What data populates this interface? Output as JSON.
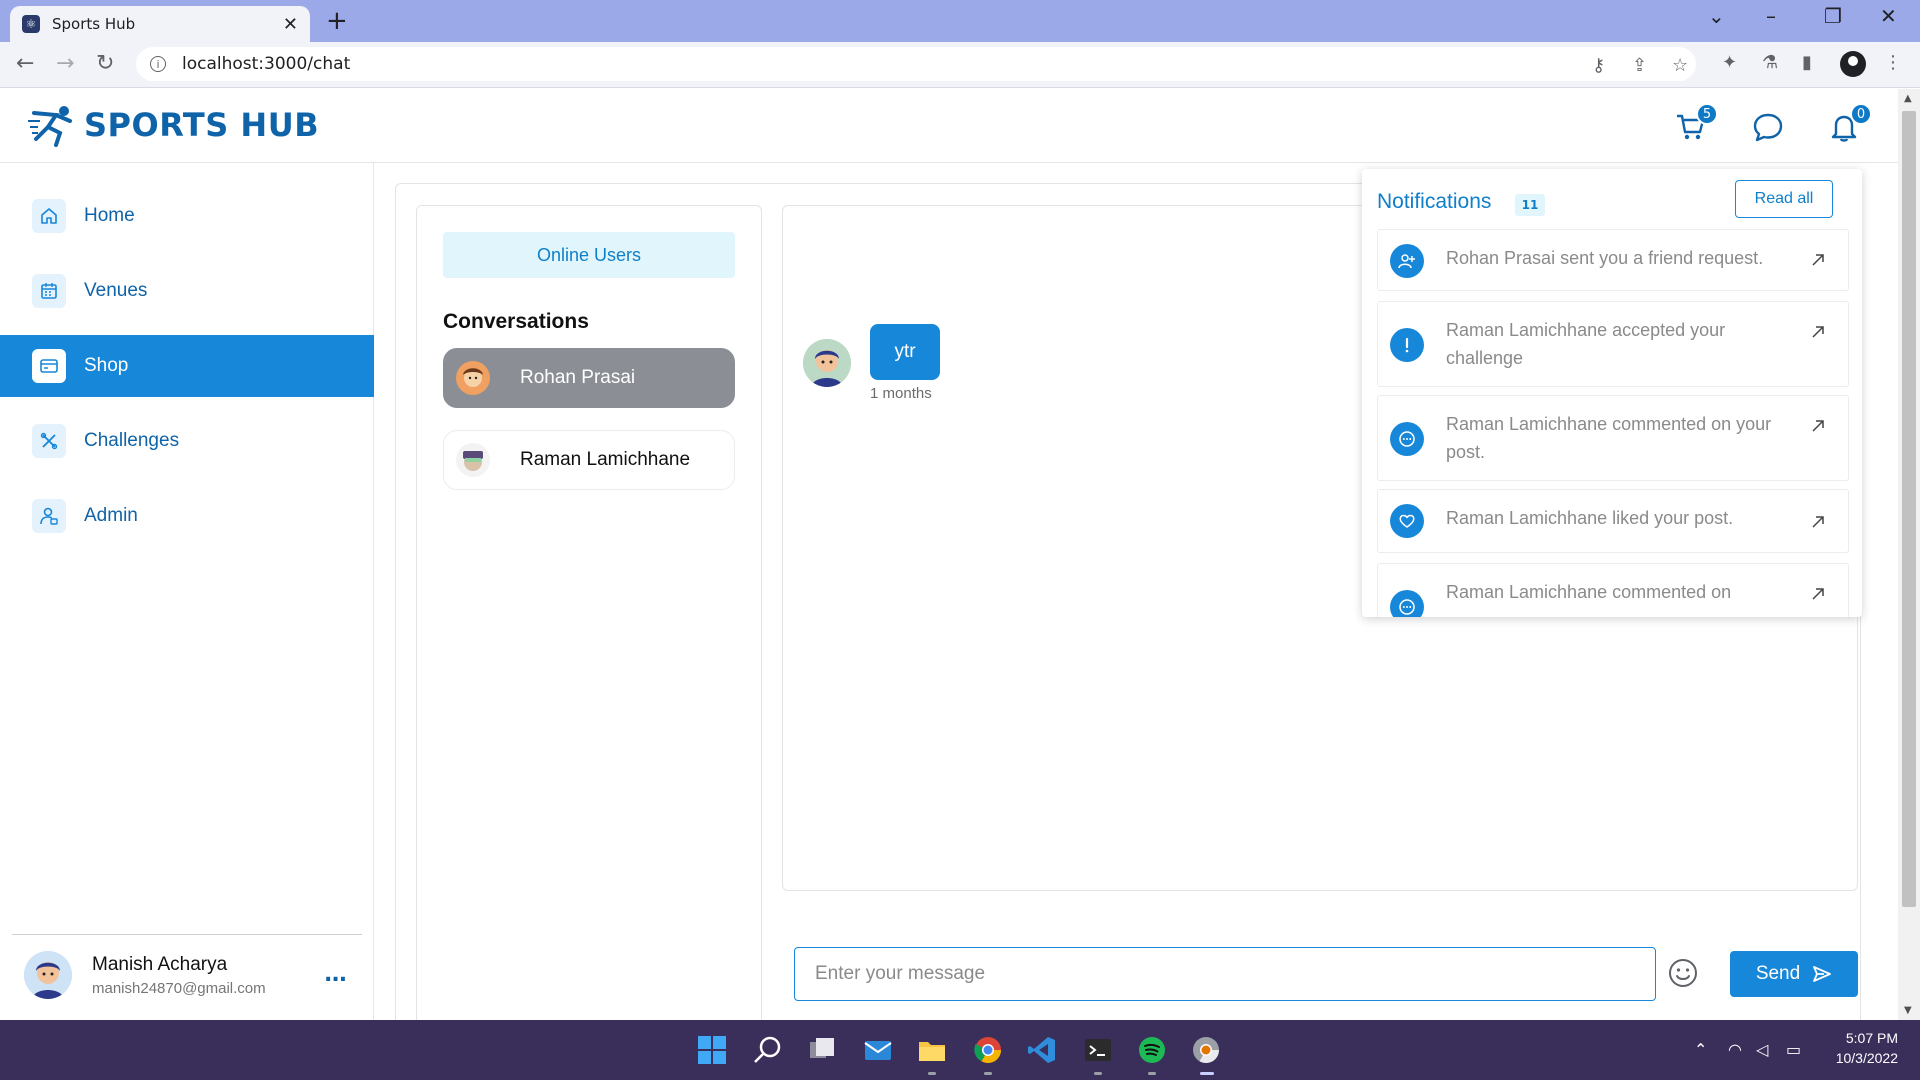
{
  "browser": {
    "tab_title": "Sports Hub",
    "url": "localhost:3000/chat"
  },
  "header": {
    "logo_text": "SPORTS HUB",
    "cart_count": "5",
    "notification_count": "0"
  },
  "sidebar": {
    "items": [
      {
        "label": "Home",
        "icon": "home-icon",
        "active": false
      },
      {
        "label": "Venues",
        "icon": "calendar-icon",
        "active": false
      },
      {
        "label": "Shop",
        "icon": "card-icon",
        "active": true
      },
      {
        "label": "Challenges",
        "icon": "tools-icon",
        "active": false
      },
      {
        "label": "Admin",
        "icon": "admin-icon",
        "active": false
      }
    ],
    "user": {
      "name": "Manish Acharya",
      "email": "manish24870@gmail.com",
      "more": "..."
    }
  },
  "conversations": {
    "online_users_label": "Online Users",
    "title": "Conversations",
    "items": [
      {
        "name": "Rohan Prasai",
        "active": true
      },
      {
        "name": "Raman Lamichhane",
        "active": false
      }
    ]
  },
  "chat": {
    "message": {
      "text": "ytr",
      "time": "1 months"
    },
    "input_placeholder": "Enter your message",
    "send_label": "Send"
  },
  "notifications": {
    "title": "Notifications",
    "count": "11",
    "read_all_label": "Read all",
    "items": [
      {
        "icon": "add-friend-icon",
        "text": "Rohan Prasai sent you a friend request."
      },
      {
        "icon": "alert-icon",
        "text": "Raman Lamichhane accepted your challenge"
      },
      {
        "icon": "comment-icon",
        "text": "Raman Lamichhane commented on your post."
      },
      {
        "icon": "heart-icon",
        "text": "Raman Lamichhane liked your post."
      },
      {
        "icon": "comment-icon",
        "text": "Raman Lamichhane commented on"
      }
    ]
  },
  "taskbar": {
    "time": "5:07 PM",
    "date": "10/3/2022"
  },
  "colors": {
    "brand": "#0f63a8",
    "accent": "#1787d9",
    "tabbar": "#9ba9e9",
    "taskbar": "#3a2f5a"
  }
}
